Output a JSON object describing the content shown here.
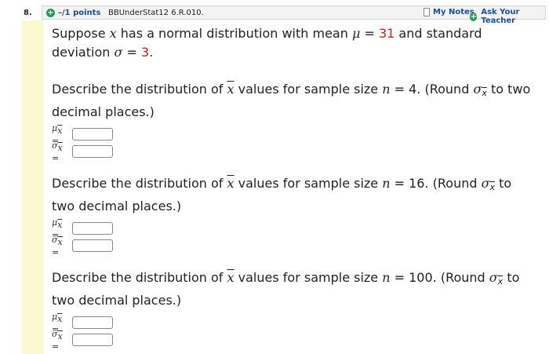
{
  "question": {
    "number": "8.",
    "points": "–/1 points",
    "code": "BBUnderStat12 6.R.010.",
    "my_notes": "My Notes",
    "ask_teacher": "Ask Your Teacher"
  },
  "intro": {
    "t1": "Suppose ",
    "x": "x",
    "t2": " has a normal distribution with mean ",
    "mu": "μ",
    "eq": " = ",
    "mean": "31",
    "t3": " and standard deviation ",
    "sigma": "σ",
    "eq2": " = ",
    "sd": "3",
    "period": "."
  },
  "parts": [
    {
      "t1": "Describe the distribution of ",
      "xbar": "x",
      "t2": " values for sample size ",
      "n": "n",
      "t3": " = 16. (Round ",
      "sig": "σ",
      "sub": "x",
      "t4": " to two decimal places.)",
      "mu_label": "μx =",
      "sigma_label": "σx =",
      "mu_value": "",
      "sigma_value": ""
    }
  ],
  "part1": {
    "text_a": "Describe the distribution of ",
    "xbar": "x",
    "text_b": " values for sample size ",
    "n": "n",
    "text_c": " = 4. (Round ",
    "sig": "σ",
    "sub": "x",
    "text_d": " to two decimal places.)",
    "mu_label": "μ",
    "mu_sub": "x",
    "sigma_label": "σ",
    "sigma_sub": "x",
    "eq": " ="
  },
  "part2": {
    "text_a": "Describe the distribution of ",
    "xbar": "x",
    "text_b": " values for sample size ",
    "n": "n",
    "text_c": " = 16. (Round ",
    "sig": "σ",
    "sub": "x",
    "text_d": " to two decimal places.)",
    "mu_label": "μ",
    "mu_sub": "x",
    "sigma_label": "σ",
    "sigma_sub": "x",
    "eq": " ="
  },
  "part3": {
    "text_a": "Describe the distribution of ",
    "xbar": "x",
    "text_b": " values for sample size ",
    "n": "n",
    "text_c": " = 100. (Round ",
    "sig": "σ",
    "sub": "x",
    "text_d": " to two decimal places.)",
    "mu_label": "μ",
    "mu_sub": "x",
    "sigma_label": "σ",
    "sigma_sub": "x",
    "eq": " ="
  },
  "colors": {
    "accent_blue": "#1a4fa3",
    "plus_green": "#1f9c52",
    "value_red": "#c8201e",
    "strip_yellow": "#fbf9cf"
  }
}
